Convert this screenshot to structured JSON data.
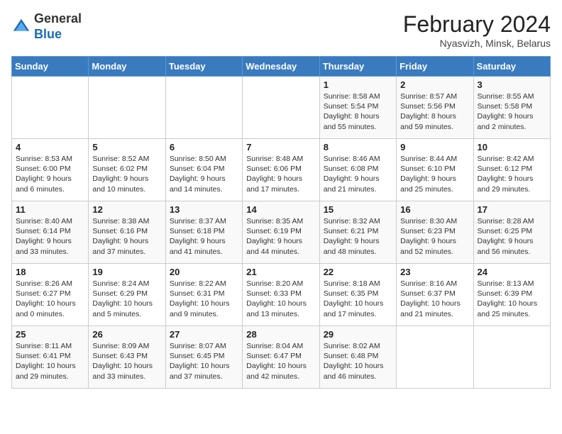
{
  "header": {
    "logo_line1": "General",
    "logo_line2": "Blue",
    "month": "February 2024",
    "location": "Nyasvizh, Minsk, Belarus"
  },
  "weekdays": [
    "Sunday",
    "Monday",
    "Tuesday",
    "Wednesday",
    "Thursday",
    "Friday",
    "Saturday"
  ],
  "weeks": [
    [
      {
        "day": "",
        "info": ""
      },
      {
        "day": "",
        "info": ""
      },
      {
        "day": "",
        "info": ""
      },
      {
        "day": "",
        "info": ""
      },
      {
        "day": "1",
        "info": "Sunrise: 8:58 AM\nSunset: 5:54 PM\nDaylight: 8 hours\nand 55 minutes."
      },
      {
        "day": "2",
        "info": "Sunrise: 8:57 AM\nSunset: 5:56 PM\nDaylight: 8 hours\nand 59 minutes."
      },
      {
        "day": "3",
        "info": "Sunrise: 8:55 AM\nSunset: 5:58 PM\nDaylight: 9 hours\nand 2 minutes."
      }
    ],
    [
      {
        "day": "4",
        "info": "Sunrise: 8:53 AM\nSunset: 6:00 PM\nDaylight: 9 hours\nand 6 minutes."
      },
      {
        "day": "5",
        "info": "Sunrise: 8:52 AM\nSunset: 6:02 PM\nDaylight: 9 hours\nand 10 minutes."
      },
      {
        "day": "6",
        "info": "Sunrise: 8:50 AM\nSunset: 6:04 PM\nDaylight: 9 hours\nand 14 minutes."
      },
      {
        "day": "7",
        "info": "Sunrise: 8:48 AM\nSunset: 6:06 PM\nDaylight: 9 hours\nand 17 minutes."
      },
      {
        "day": "8",
        "info": "Sunrise: 8:46 AM\nSunset: 6:08 PM\nDaylight: 9 hours\nand 21 minutes."
      },
      {
        "day": "9",
        "info": "Sunrise: 8:44 AM\nSunset: 6:10 PM\nDaylight: 9 hours\nand 25 minutes."
      },
      {
        "day": "10",
        "info": "Sunrise: 8:42 AM\nSunset: 6:12 PM\nDaylight: 9 hours\nand 29 minutes."
      }
    ],
    [
      {
        "day": "11",
        "info": "Sunrise: 8:40 AM\nSunset: 6:14 PM\nDaylight: 9 hours\nand 33 minutes."
      },
      {
        "day": "12",
        "info": "Sunrise: 8:38 AM\nSunset: 6:16 PM\nDaylight: 9 hours\nand 37 minutes."
      },
      {
        "day": "13",
        "info": "Sunrise: 8:37 AM\nSunset: 6:18 PM\nDaylight: 9 hours\nand 41 minutes."
      },
      {
        "day": "14",
        "info": "Sunrise: 8:35 AM\nSunset: 6:19 PM\nDaylight: 9 hours\nand 44 minutes."
      },
      {
        "day": "15",
        "info": "Sunrise: 8:32 AM\nSunset: 6:21 PM\nDaylight: 9 hours\nand 48 minutes."
      },
      {
        "day": "16",
        "info": "Sunrise: 8:30 AM\nSunset: 6:23 PM\nDaylight: 9 hours\nand 52 minutes."
      },
      {
        "day": "17",
        "info": "Sunrise: 8:28 AM\nSunset: 6:25 PM\nDaylight: 9 hours\nand 56 minutes."
      }
    ],
    [
      {
        "day": "18",
        "info": "Sunrise: 8:26 AM\nSunset: 6:27 PM\nDaylight: 10 hours\nand 0 minutes."
      },
      {
        "day": "19",
        "info": "Sunrise: 8:24 AM\nSunset: 6:29 PM\nDaylight: 10 hours\nand 5 minutes."
      },
      {
        "day": "20",
        "info": "Sunrise: 8:22 AM\nSunset: 6:31 PM\nDaylight: 10 hours\nand 9 minutes."
      },
      {
        "day": "21",
        "info": "Sunrise: 8:20 AM\nSunset: 6:33 PM\nDaylight: 10 hours\nand 13 minutes."
      },
      {
        "day": "22",
        "info": "Sunrise: 8:18 AM\nSunset: 6:35 PM\nDaylight: 10 hours\nand 17 minutes."
      },
      {
        "day": "23",
        "info": "Sunrise: 8:16 AM\nSunset: 6:37 PM\nDaylight: 10 hours\nand 21 minutes."
      },
      {
        "day": "24",
        "info": "Sunrise: 8:13 AM\nSunset: 6:39 PM\nDaylight: 10 hours\nand 25 minutes."
      }
    ],
    [
      {
        "day": "25",
        "info": "Sunrise: 8:11 AM\nSunset: 6:41 PM\nDaylight: 10 hours\nand 29 minutes."
      },
      {
        "day": "26",
        "info": "Sunrise: 8:09 AM\nSunset: 6:43 PM\nDaylight: 10 hours\nand 33 minutes."
      },
      {
        "day": "27",
        "info": "Sunrise: 8:07 AM\nSunset: 6:45 PM\nDaylight: 10 hours\nand 37 minutes."
      },
      {
        "day": "28",
        "info": "Sunrise: 8:04 AM\nSunset: 6:47 PM\nDaylight: 10 hours\nand 42 minutes."
      },
      {
        "day": "29",
        "info": "Sunrise: 8:02 AM\nSunset: 6:48 PM\nDaylight: 10 hours\nand 46 minutes."
      },
      {
        "day": "",
        "info": ""
      },
      {
        "day": "",
        "info": ""
      }
    ]
  ]
}
